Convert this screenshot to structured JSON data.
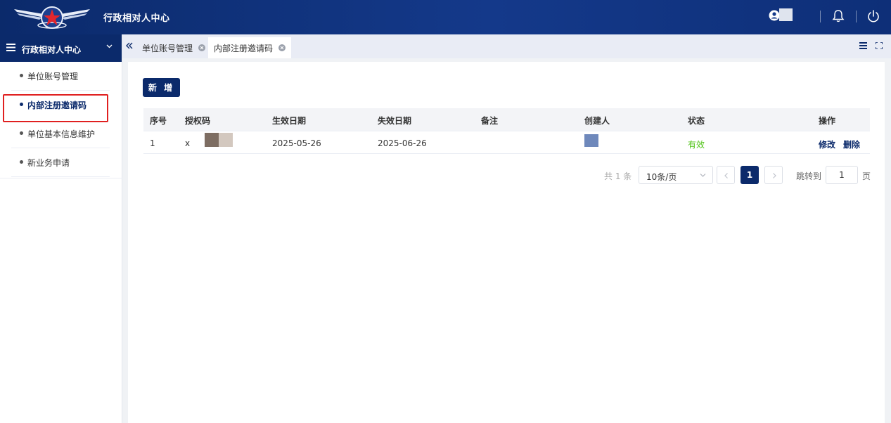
{
  "header": {
    "app_title": "行政相对人中心"
  },
  "sidebar": {
    "title": "行政相对人中心",
    "items": [
      {
        "label": "单位账号管理"
      },
      {
        "label": "内部注册邀请码"
      },
      {
        "label": "单位基本信息维护"
      },
      {
        "label": "新业务申请"
      }
    ],
    "active_index": 1
  },
  "tabs": [
    {
      "label": "单位账号管理",
      "active": false
    },
    {
      "label": "内部注册邀请码",
      "active": true
    }
  ],
  "main": {
    "add_button": "新 增",
    "table": {
      "columns": [
        "序号",
        "授权码",
        "生效日期",
        "失效日期",
        "备注",
        "创建人",
        "状态",
        "操作"
      ],
      "rows": [
        {
          "index": "1",
          "auth_code": "x",
          "start_date": "2025-05-26",
          "end_date": "2025-06-26",
          "remark": "",
          "creator": "",
          "status": "有效",
          "actions": [
            "修改",
            "删除"
          ]
        }
      ]
    },
    "pagination": {
      "total": "共 1 条",
      "page_size": "10条/页",
      "current_page": "1",
      "jump_label": "跳转到",
      "jump_value": "1",
      "page_suffix": "页"
    }
  },
  "colors": {
    "primary": "#0b2a6b",
    "status_valid": "#52c41a",
    "highlight": "#e02020"
  },
  "icons": [
    "logo-icon",
    "user-icon",
    "bell-icon",
    "power-icon",
    "menu-icon",
    "chevron-down-icon",
    "collapse-icon",
    "close-icon",
    "fullscreen-icon",
    "chevron-left-icon",
    "chevron-right-icon"
  ]
}
